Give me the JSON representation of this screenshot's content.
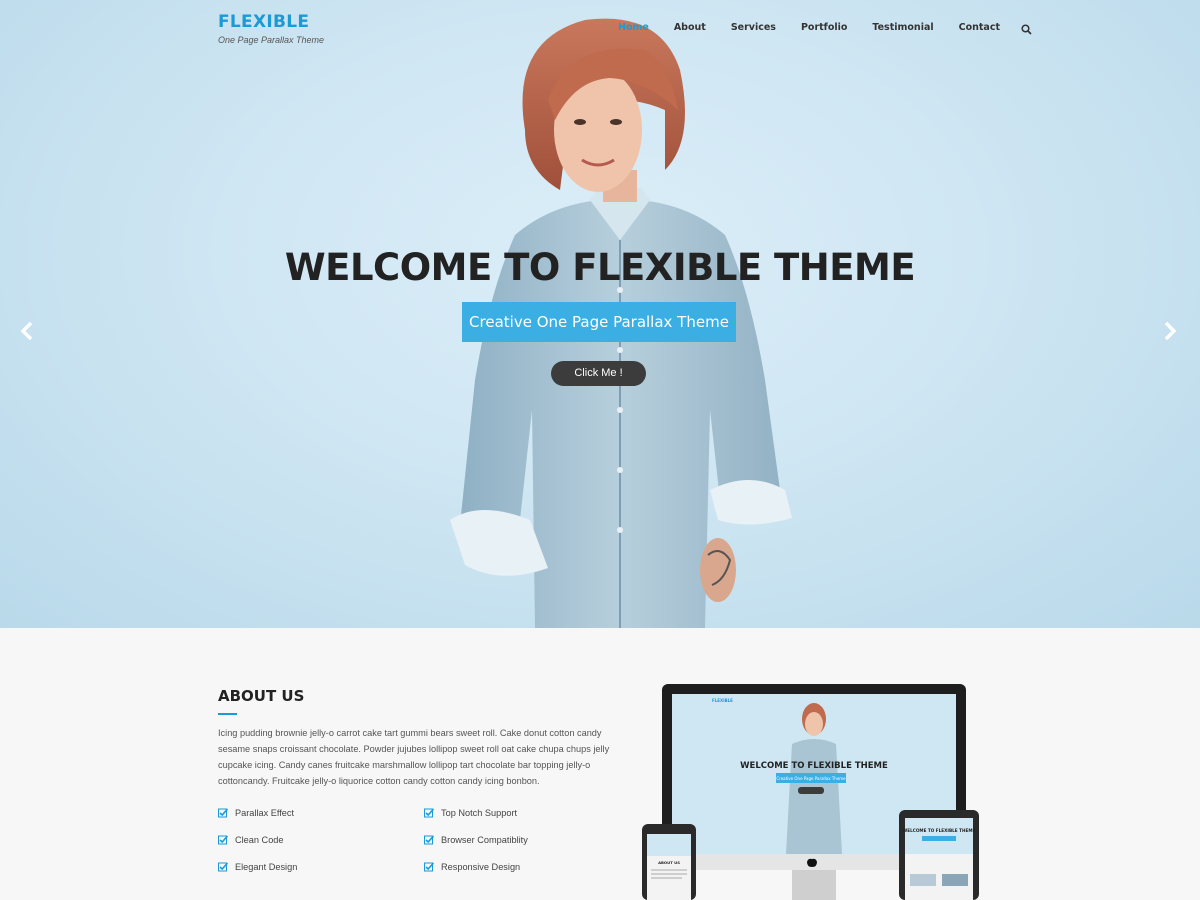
{
  "header": {
    "logo_title": "FLEXIBLE",
    "logo_tagline": "One Page Parallax Theme",
    "nav": [
      "Home",
      "About",
      "Services",
      "Portfolio",
      "Testimonial",
      "Contact"
    ],
    "active_nav": "Home",
    "search_icon": "search-icon"
  },
  "hero": {
    "title": "WELCOME TO FLEXIBLE THEME",
    "subtitle": "Creative One Page Parallax Theme",
    "button_label": "Click Me !",
    "prev_icon": "chevron-left-icon",
    "next_icon": "chevron-right-icon"
  },
  "about": {
    "title": "ABOUT US",
    "text": "Icing pudding brownie jelly-o carrot cake tart gummi bears sweet roll. Cake donut cotton candy sesame snaps croissant chocolate. Powder jujubes lollipop sweet roll oat cake chupa chups jelly cupcake icing. Candy canes fruitcake marshmallow lollipop tart chocolate bar topping jelly-o cottoncandy. Fruitcake jelly-o liquorice cotton candy cotton candy icing bonbon.",
    "features": [
      "Parallax Effect",
      "Top Notch Support",
      "Clean Code",
      "Browser Compatiblity",
      "Elegant Design",
      "Responsive Design"
    ]
  },
  "devices_preview": {
    "desktop_title": "WELCOME TO FLEXIBLE THEME",
    "desktop_subtitle": "Creative One Page Parallax Theme",
    "logo": "FLEXIBLE",
    "tablet_title": "WELCOME TO FLEXIBLE THEME",
    "phone_section": "ABOUT US"
  },
  "colors": {
    "accent": "#1a9ad6",
    "button_dark": "#3c3c3c",
    "subtitle_bg": "#3baee3"
  }
}
